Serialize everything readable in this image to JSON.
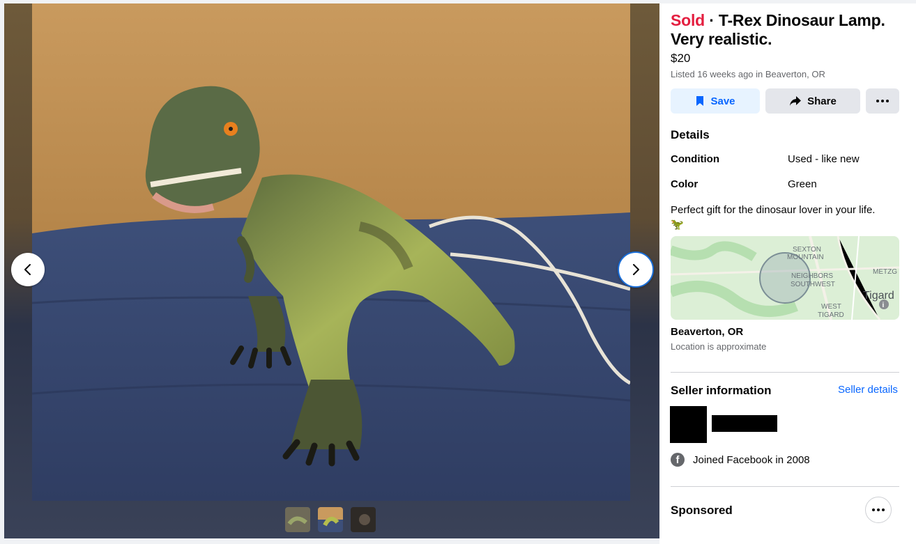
{
  "listing": {
    "status": "Sold",
    "separator": " · ",
    "title": "T-Rex Dinosaur Lamp. Very realistic.",
    "price": "$20",
    "listed": "Listed 16 weeks ago in Beaverton, OR"
  },
  "actions": {
    "save_label": "Save",
    "share_label": "Share"
  },
  "details": {
    "heading": "Details",
    "rows": [
      {
        "label": "Condition",
        "value": "Used - like new"
      },
      {
        "label": "Color",
        "value": "Green"
      }
    ],
    "description": "Perfect gift for the dinosaur lover in your life.",
    "description_emoji": "🦖"
  },
  "map": {
    "labels": [
      "SEXTON",
      "MOUNTAIN",
      "NEIGHBORS",
      "SOUTHWEST",
      "METZG",
      "Tigard",
      "WEST",
      "TIGARD"
    ],
    "location": "Beaverton, OR",
    "note": "Location is approximate"
  },
  "seller": {
    "heading": "Seller information",
    "details_link": "Seller details",
    "joined": "Joined Facebook in 2008"
  },
  "sponsored": {
    "heading": "Sponsored"
  },
  "colors": {
    "sold": "#e41e3f",
    "accent": "#0866ff",
    "secondary_text": "#65676b"
  },
  "icons": {
    "prev": "chevron-left-icon",
    "next": "chevron-right-icon",
    "save": "bookmark-icon",
    "share": "share-arrow-icon",
    "more": "more-dots-icon",
    "facebook": "facebook-icon"
  }
}
